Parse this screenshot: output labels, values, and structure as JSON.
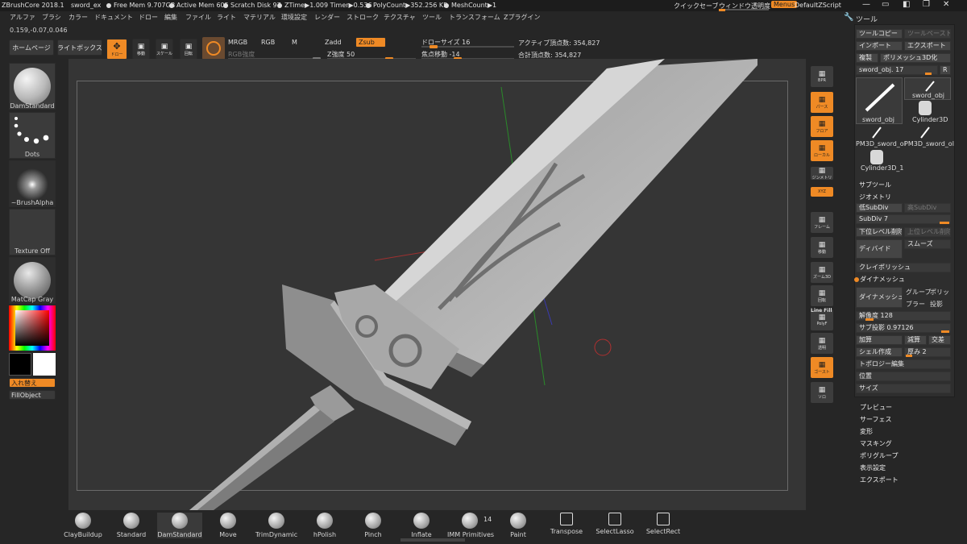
{
  "titlebar": {
    "app": "ZBrushCore 2018.1",
    "file": "sword_ex",
    "free_mem": "Free Mem 9.707GB",
    "active_mem": "Active Mem 605",
    "scratch": "Scratch Disk 97",
    "ztime": "ZTime▶1.009 Timer▶0.536",
    "polycount": "PolyCount▶352.256 KP",
    "meshcount": "MeshCount▶1",
    "quicksave": "クイックセーブ",
    "window_transparency": "ウィンドウ透明度",
    "menus": "Menus",
    "default_zscript": "DefaultZScript"
  },
  "menu": [
    "アルファ",
    "ブラシ",
    "カラー",
    "ドキュメント",
    "ドロー",
    "編集",
    "ファイル",
    "ライト",
    "マテリアル",
    "環境設定",
    "レンダー",
    "ストローク",
    "テクスチャ",
    "ツール",
    "トランスフォーム",
    "Zプラグイン"
  ],
  "coords": "0.159,-0.07,0.046",
  "toolbar": {
    "home": "ホームページ",
    "lightbox": "ライトボックス",
    "draw": "ドロー",
    "move": "移動",
    "scale": "スケール",
    "rotate": "回転",
    "mrgb": "MRGB",
    "rgb": "RGB",
    "m": "M",
    "zadd": "Zadd",
    "zsub": "Zsub",
    "rgb_intensity": "RGB強度",
    "z_intensity": "Z強度 50",
    "draw_size": "ドローサイズ 16",
    "focal_shift": "焦点移動 -14",
    "active_points": "アクティブ頂点数: 354,827",
    "total_points": "合計頂点数: 354,827"
  },
  "left": {
    "brush": "DamStandard",
    "stroke": "Dots",
    "alpha": "~BrushAlpha",
    "texture": "Texture Off",
    "material": "MatCap Gray",
    "swap": "入れ替え",
    "fill": "FillObject"
  },
  "rightbar": [
    {
      "label": "BPR"
    },
    {
      "label": "パース"
    },
    {
      "label": "フロア"
    },
    {
      "label": "ローカル"
    },
    {
      "label": "ジンメトリ"
    },
    {
      "label": "XYZ"
    },
    {
      "label": "フレーム"
    },
    {
      "label": "移動"
    },
    {
      "label": "ズーム3D"
    },
    {
      "label": "回転"
    },
    {
      "label": "PolyF"
    },
    {
      "label": "透明"
    },
    {
      "label": "ゴースト"
    },
    {
      "label": "ソロ"
    }
  ],
  "linefill": "Line Fill",
  "panel": {
    "title": "ツール",
    "copy": "ツールコピー",
    "paste": "ツールペースト",
    "import": "インポート",
    "export": "エクスポート",
    "clone": "複製",
    "polymesh": "ポリメッシュ3D化",
    "current": "sword_obj. 17",
    "r": "R",
    "thumbs": [
      "sword_obj",
      "sword_obj",
      "Cylinder3D",
      "PM3D_sword_ol",
      "PM3D_sword_ol",
      "Cylinder3D_1"
    ],
    "subtool": "サブツール",
    "geometry": "ジオメトリ",
    "lower": "低SubDiv",
    "higher": "高SubDiv",
    "subdiv": "SubDiv 7",
    "del_lower": "下位レベル削除",
    "del_higher": "上位レベル削除",
    "divide": "ディバイド",
    "smooth": "スムーズ",
    "claypolish": "クレイポリッシュ",
    "dynamesh_sec": "ダイナメッシュ",
    "dynamesh": "ダイナメッシュ",
    "groups": "グループ",
    "polish": "ポリッ",
    "blur": "ブラー",
    "project": "投影",
    "resolution": "解像度 128",
    "subproject": "サブ投影 0.97126",
    "add": "加算",
    "sub": "減算",
    "intersect": "交差",
    "shell": "シェル作成",
    "thickness": "厚み 2",
    "topology": "トポロジー編集",
    "position": "位置",
    "size": "サイズ",
    "sections": [
      "プレビュー",
      "サーフェス",
      "変形",
      "マスキング",
      "ポリグループ",
      "表示設定",
      "エクスポート"
    ]
  },
  "brushes": [
    "ClayBuildup",
    "Standard",
    "DamStandard",
    "Move",
    "TrimDynamic",
    "hPolish",
    "Pinch",
    "Inflate",
    "IMM Primitives",
    "Paint",
    "Transpose",
    "SelectLasso",
    "SelectRect"
  ],
  "imm_count": "14"
}
